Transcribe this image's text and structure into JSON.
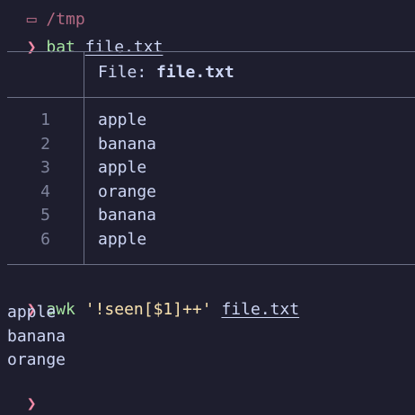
{
  "top_clip": {
    "icon": "folder-icon",
    "text": "/tmp"
  },
  "prompt_symbol": "❯",
  "command1": {
    "cmd": "bat",
    "arg": "file.txt"
  },
  "bat": {
    "header_prefix": "File: ",
    "header_file": "file.txt",
    "lines": [
      {
        "num": "1",
        "text": "apple"
      },
      {
        "num": "2",
        "text": "banana"
      },
      {
        "num": "3",
        "text": "apple"
      },
      {
        "num": "4",
        "text": "orange"
      },
      {
        "num": "5",
        "text": "banana"
      },
      {
        "num": "6",
        "text": "apple"
      }
    ]
  },
  "command2": {
    "cmd": "awk",
    "script": "'!seen[$1]++'",
    "arg": "file.txt"
  },
  "output2": [
    "apple",
    "banana",
    "orange"
  ],
  "colors": {
    "background": "#1e1e2e",
    "text": "#cdd6f4",
    "prompt": "#f38ba8",
    "command": "#a6e3a1",
    "string": "#f9e2af",
    "rule": "#6c7086",
    "line_number": "#7f849c"
  }
}
